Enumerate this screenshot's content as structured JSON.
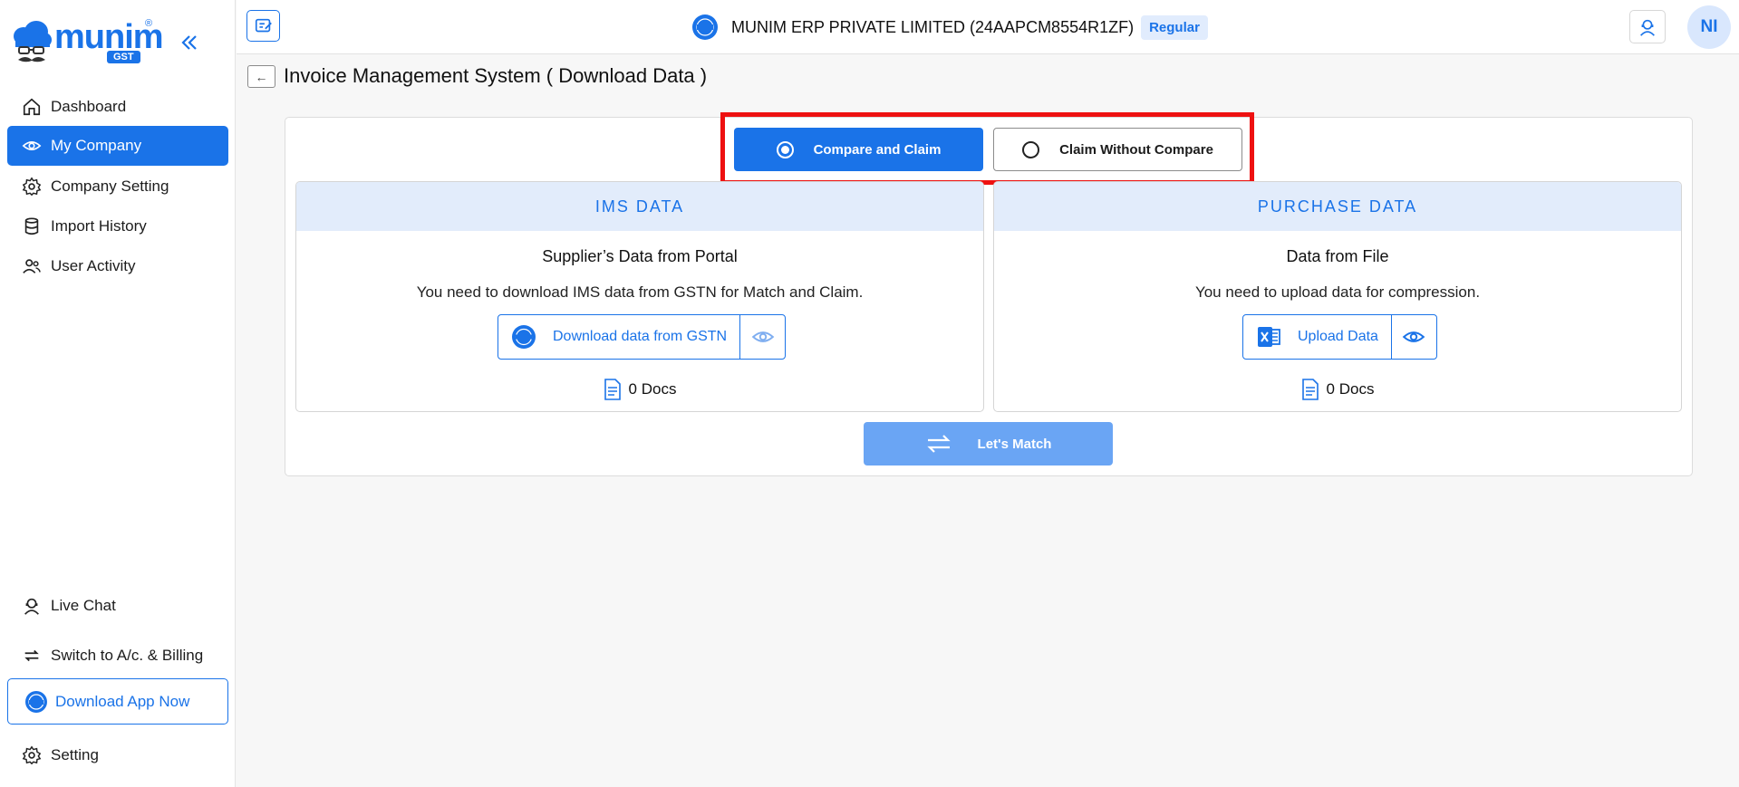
{
  "sidebar": {
    "logo_text": "munim",
    "logo_badge": "GST",
    "logo_reg": "®",
    "items": [
      {
        "label": "Dashboard",
        "icon": "home-icon"
      },
      {
        "label": "My Company",
        "icon": "eye-icon",
        "active": true
      },
      {
        "label": "Company Setting",
        "icon": "gear-icon"
      },
      {
        "label": "Import History",
        "icon": "database-icon"
      },
      {
        "label": "User Activity",
        "icon": "users-icon"
      }
    ],
    "bottom": {
      "live_chat": "Live Chat",
      "switch": "Switch to A/c. & Billing",
      "download_app": "Download App Now",
      "setting": "Setting"
    }
  },
  "header": {
    "company_name": "MUNIM ERP PRIVATE LIMITED (24AAPCM8554R1ZF)",
    "company_type": "Regular",
    "avatar_initials": "NI"
  },
  "page": {
    "back_symbol": "←",
    "title": "Invoice Management System ( Download Data )"
  },
  "mode_options": {
    "compare": "Compare and Claim",
    "without_compare": "Claim Without Compare",
    "selected": "compare"
  },
  "ims_panel": {
    "heading": "IMS DATA",
    "subtitle": "Supplier’s Data from Portal",
    "description": "You need to download IMS data from GSTN for Match and Claim.",
    "action_label": "Download data from GSTN",
    "docs": "0 Docs"
  },
  "purchase_panel": {
    "heading": "PURCHASE DATA",
    "subtitle": "Data from File",
    "description": "You need to upload data for compression.",
    "action_label": "Upload Data",
    "docs": "0 Docs"
  },
  "match_button": "Let's Match",
  "colors": {
    "accent": "#1a73e8",
    "highlight": "#ee1111",
    "panel_header_bg": "#e2ecfb",
    "match_disabled": "#6aa5f4"
  }
}
